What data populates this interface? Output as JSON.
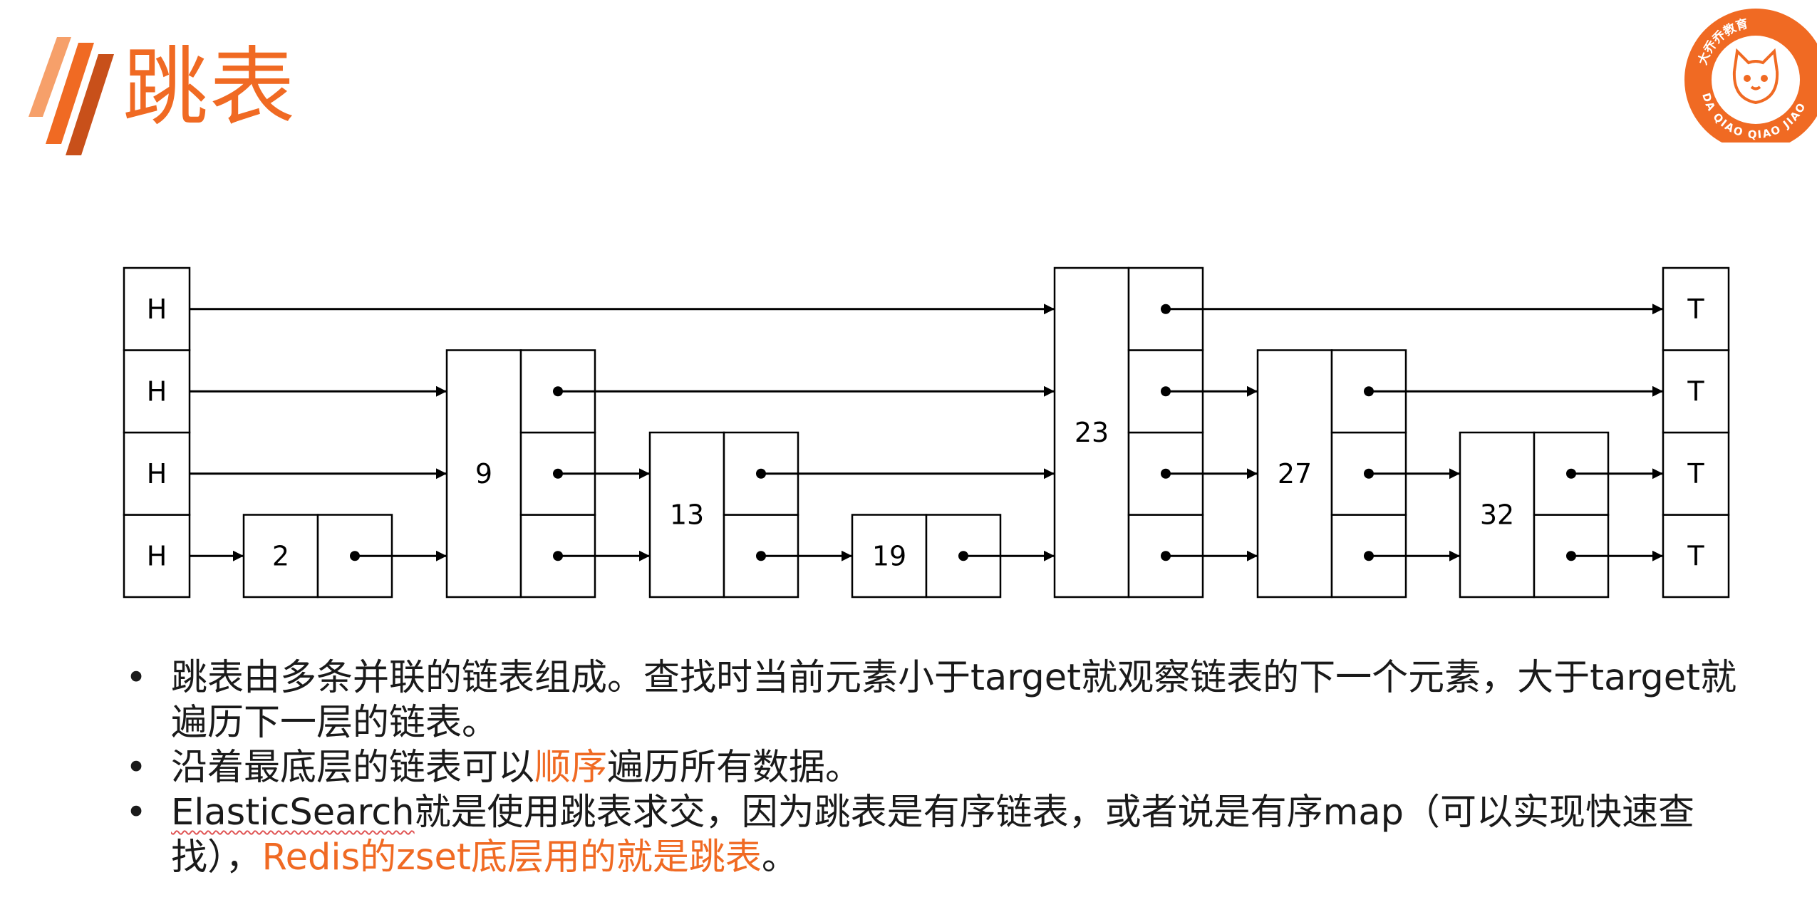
{
  "title": "跳表",
  "logo": {
    "ring_text": "大乔乔教育 · DA QIAO QIAO JIAO YU",
    "top_text": "大乔乔教育",
    "bottom_text": "DA QIAO QIAO JIAO"
  },
  "colors": {
    "accent": "#F06A23",
    "text": "#1a1a1a",
    "line": "#000000"
  },
  "diagram": {
    "head_label": "H",
    "tail_label": "T",
    "nodes": [
      {
        "value": "2",
        "levels": 1
      },
      {
        "value": "9",
        "levels": 3
      },
      {
        "value": "13",
        "levels": 2
      },
      {
        "value": "19",
        "levels": 1
      },
      {
        "value": "23",
        "levels": 4
      },
      {
        "value": "27",
        "levels": 3
      },
      {
        "value": "32",
        "levels": 2
      }
    ]
  },
  "bullets": [
    {
      "parts": [
        {
          "text": "跳表由多条并联的链表组成。查找时当前元素小于target就观察链表的下一个元素，大于target就遍历下一层的链表。",
          "style": "normal"
        }
      ]
    },
    {
      "parts": [
        {
          "text": "沿着最底层的链表可以",
          "style": "normal"
        },
        {
          "text": "顺序",
          "style": "highlight"
        },
        {
          "text": "遍历所有数据。",
          "style": "normal"
        }
      ]
    },
    {
      "parts": [
        {
          "text": "ElasticSearch",
          "style": "underline"
        },
        {
          "text": "就是使用跳表求交，因为跳表是有序链表，或者说是有序map（可以实现快速查找），",
          "style": "normal"
        },
        {
          "text": "Redis的zset底层用的就是跳表",
          "style": "highlight"
        },
        {
          "text": "。",
          "style": "normal"
        }
      ]
    }
  ]
}
